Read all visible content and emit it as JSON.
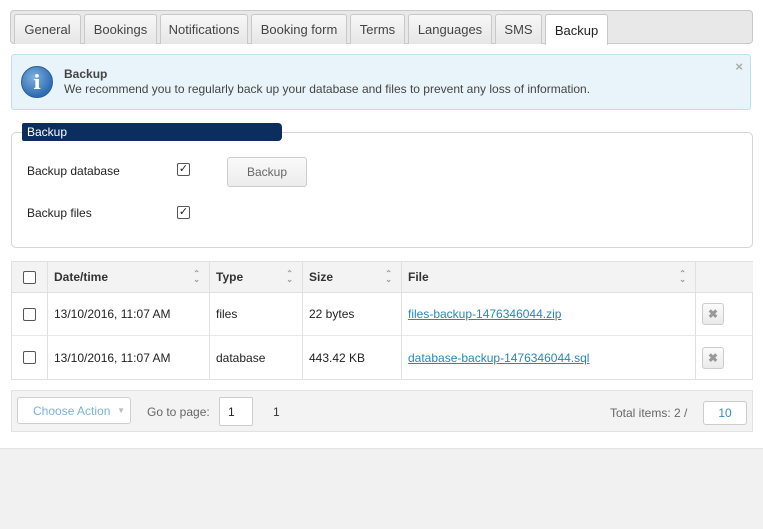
{
  "tabs": [
    "General",
    "Bookings",
    "Notifications",
    "Booking form",
    "Terms",
    "Languages",
    "SMS",
    "Backup"
  ],
  "active_tab": "Backup",
  "notice": {
    "title": "Backup",
    "text": "We recommend you to regularly back up your database and files to prevent any loss of information.",
    "close": "×"
  },
  "backup_section": {
    "legend": "Backup",
    "database_label": "Backup database",
    "database_checked": true,
    "files_label": "Backup files",
    "files_checked": true,
    "button_label": "Backup"
  },
  "table": {
    "columns": [
      "Date/time",
      "Type",
      "Size",
      "File"
    ],
    "rows": [
      {
        "datetime": "13/10/2016, 11:07 AM",
        "type": "files",
        "size": "22 bytes",
        "file": "files-backup-1476346044.zip"
      },
      {
        "datetime": "13/10/2016, 11:07 AM",
        "type": "database",
        "size": "443.42 KB",
        "file": "database-backup-1476346044.sql"
      }
    ]
  },
  "footer": {
    "choose_action": "Choose Action",
    "goto_label": "Go to page:",
    "page_value": "1",
    "page_number": "1",
    "total_label": "Total items: 2 /",
    "per_page": "10"
  },
  "colors": {
    "legend_bg": "#0b2e5f",
    "link": "#2a86b7",
    "notice_bg": "#e8f4fa"
  }
}
